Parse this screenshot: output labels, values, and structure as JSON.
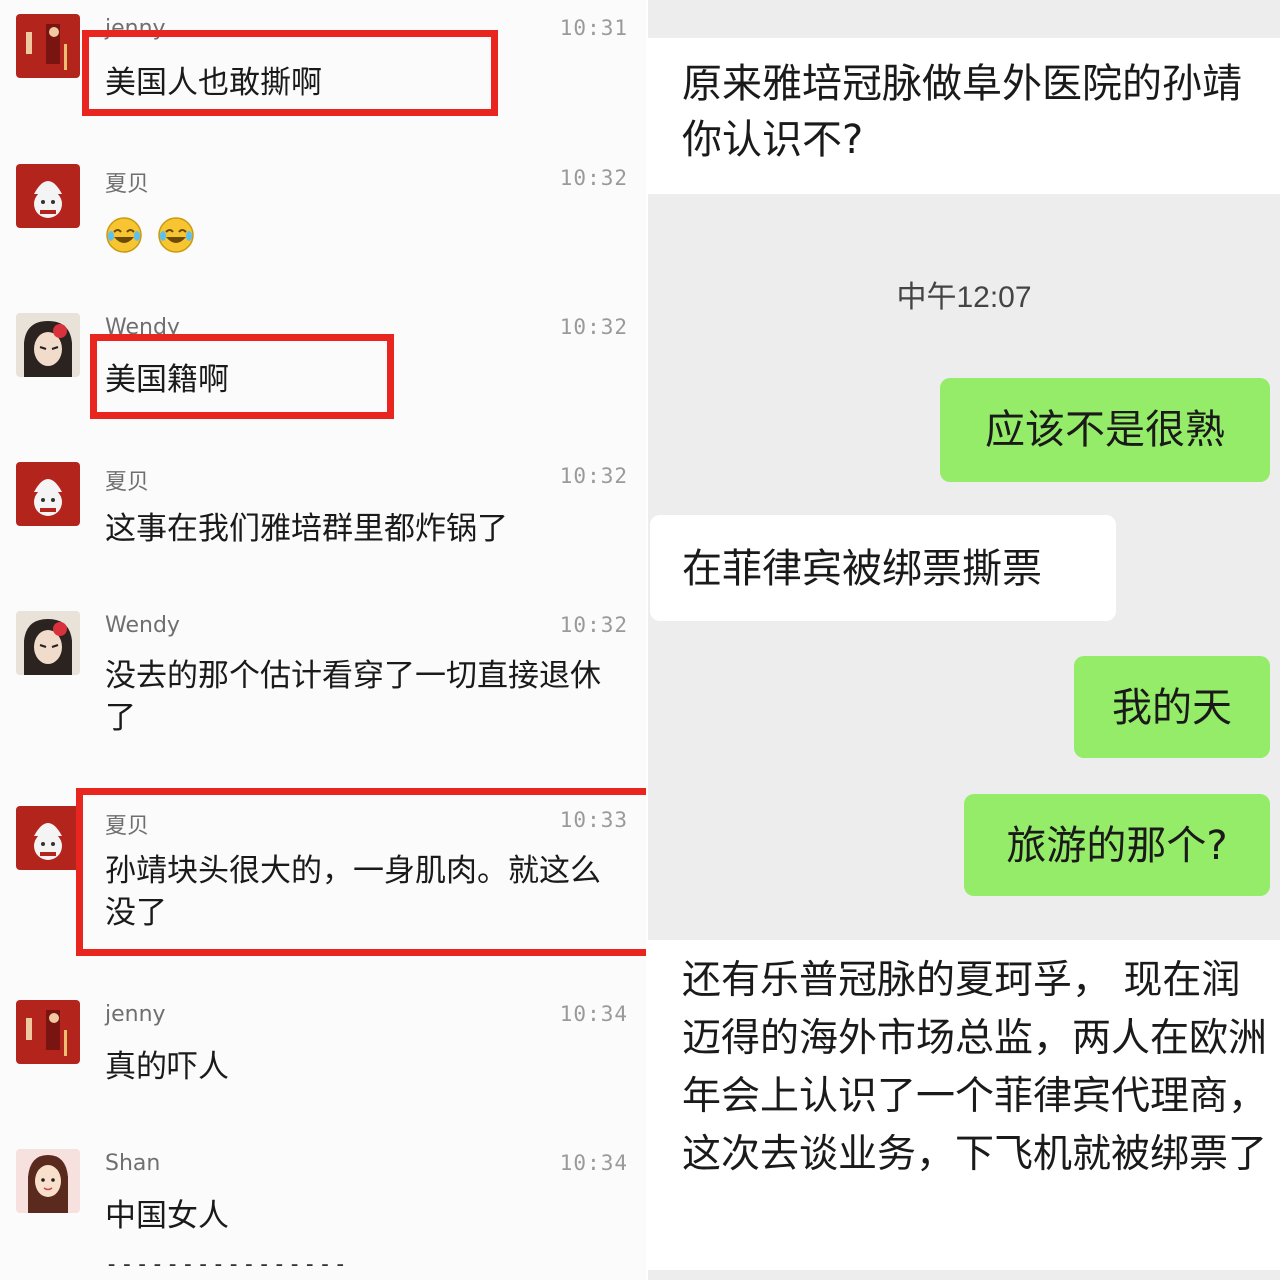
{
  "left_chat": {
    "messages": [
      {
        "sender": "jenny",
        "time": "10:31",
        "text": "美国人也敢撕啊"
      },
      {
        "sender": "夏贝",
        "time": "10:32",
        "text": ""
      },
      {
        "sender": "Wendy",
        "time": "10:32",
        "text": "美国籍啊"
      },
      {
        "sender": "夏贝",
        "time": "10:32",
        "text": "这事在我们雅培群里都炸锅了"
      },
      {
        "sender": "Wendy",
        "time": "10:32",
        "text": "没去的那个估计看穿了一切直接退休了"
      },
      {
        "sender": "夏贝",
        "time": "10:33",
        "text": "孙靖块头很大的，一身肌肉。就这么没了"
      },
      {
        "sender": "jenny",
        "time": "10:34",
        "text": "真的吓人"
      },
      {
        "sender": "Shan",
        "time": "10:34",
        "text": "中国女人"
      }
    ],
    "trailing_dashes": "----------------",
    "emoji_icon": "laughing-tears-icon",
    "highlight_color": "#e8261f"
  },
  "right_chat": {
    "top_message": "原来雅培冠脉做阜外医院的孙靖你认识不?",
    "timestamp": "中午12:07",
    "reply_1": "应该不是很熟",
    "incoming_1": "在菲律宾被绑票撕票",
    "reply_2": "我的天",
    "reply_3": "旅游的那个?",
    "incoming_2": "还有乐普冠脉的夏珂孚， 现在润迈得的海外市场总监，两人在欧洲年会上认识了一个菲律宾代理商，这次去谈业务，下飞机就被绑票了",
    "sent_bubble_color": "#95ec69"
  }
}
